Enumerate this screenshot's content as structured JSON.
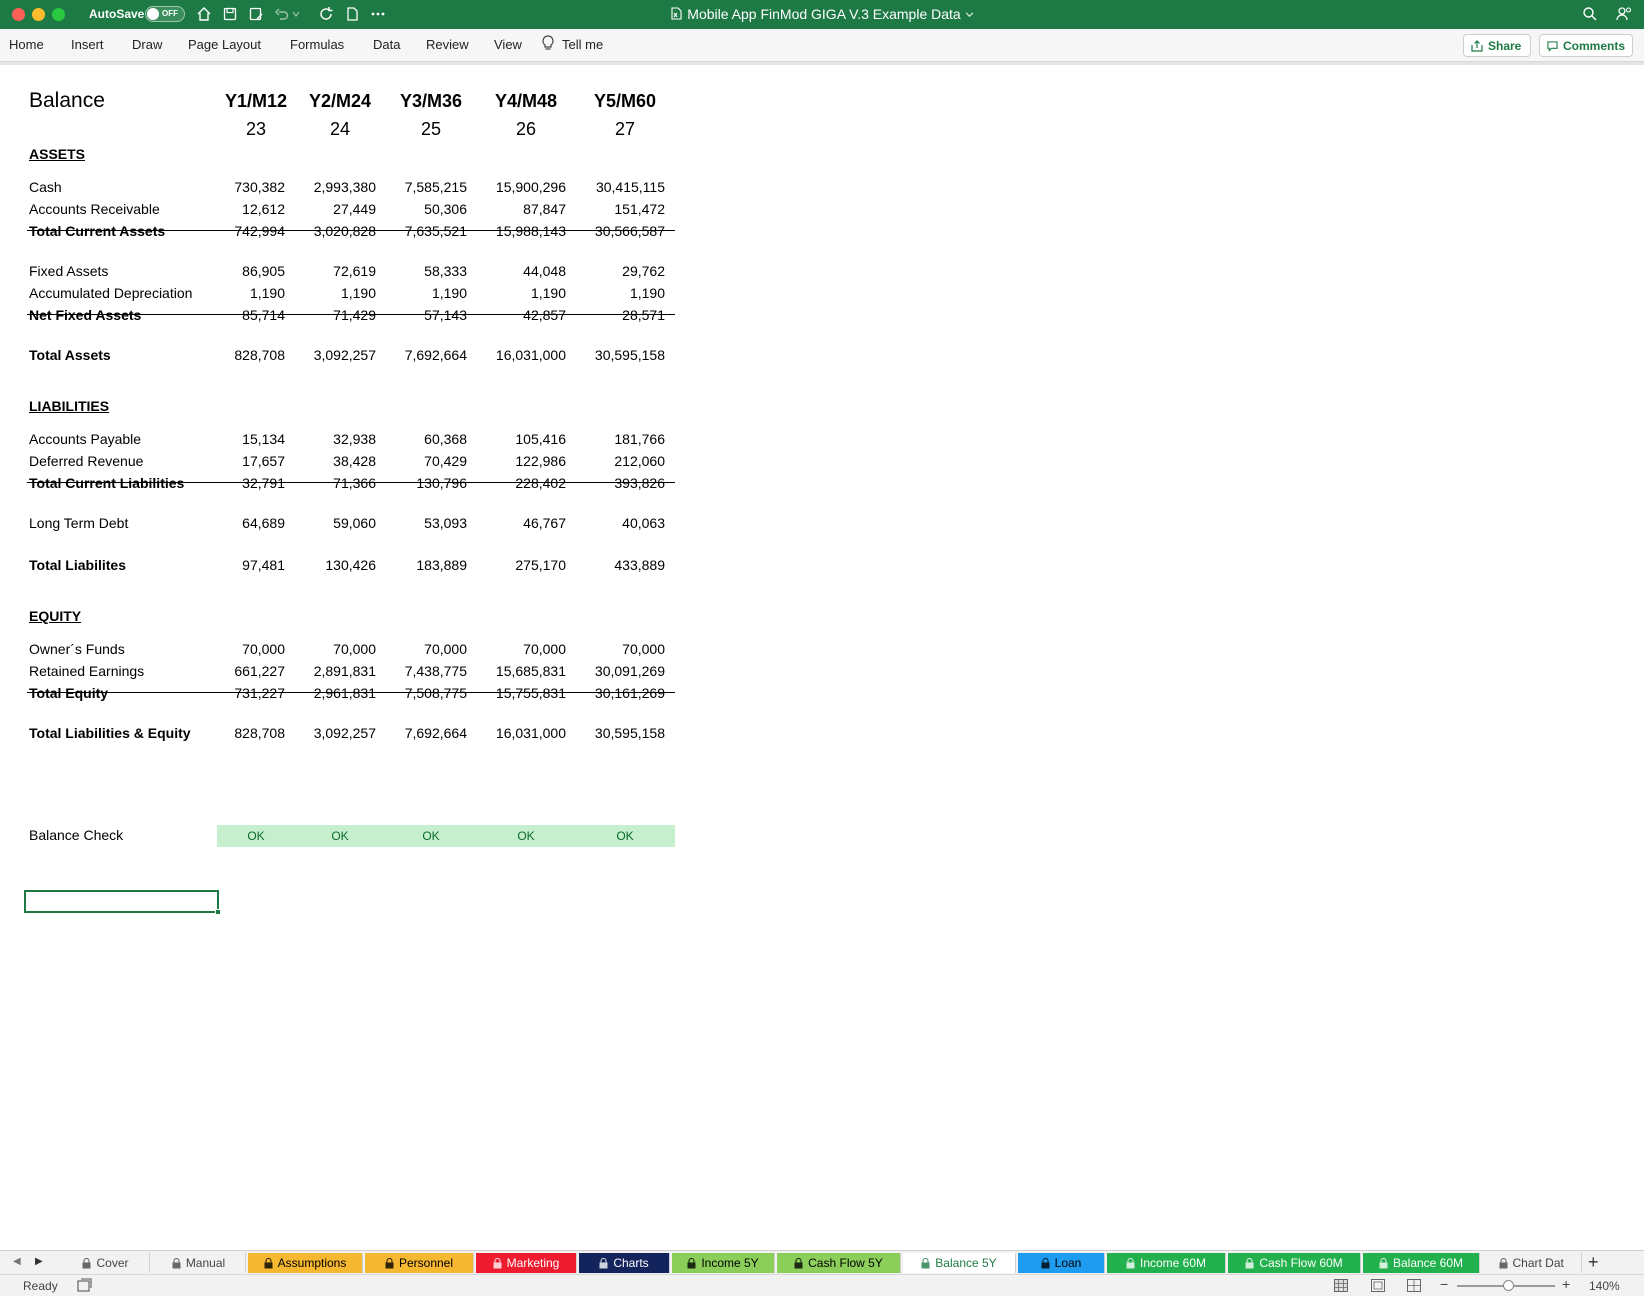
{
  "titlebar": {
    "autosave_label": "AutoSave",
    "autosave_state": "OFF",
    "document_title": "Mobile App FinMod GIGA V.3 Example Data"
  },
  "ribbon": {
    "menu": [
      "Home",
      "Insert",
      "Draw",
      "Page Layout",
      "Formulas",
      "Data",
      "Review",
      "View",
      "Tell me"
    ],
    "share_label": "Share",
    "comments_label": "Comments"
  },
  "sheet": {
    "title": "Balance",
    "columns": [
      "Y1/M12",
      "Y2/M24",
      "Y3/M36",
      "Y4/M48",
      "Y5/M60"
    ],
    "column_numbers": [
      "23",
      "24",
      "25",
      "26",
      "27"
    ],
    "sections": {
      "assets": "ASSETS",
      "liabilities": "LIABILITIES",
      "equity": "EQUITY"
    },
    "rows": [
      {
        "label": "Cash",
        "values": [
          "730,382",
          "2,993,380",
          "7,585,215",
          "15,900,296",
          "30,415,115"
        ]
      },
      {
        "label": "Accounts Receivable",
        "values": [
          "12,612",
          "27,449",
          "50,306",
          "87,847",
          "151,472"
        ]
      },
      {
        "label": "Total Current Assets",
        "values": [
          "742,994",
          "3,020,828",
          "7,635,521",
          "15,988,143",
          "30,566,587"
        ]
      },
      {
        "label": "Fixed Assets",
        "values": [
          "86,905",
          "72,619",
          "58,333",
          "44,048",
          "29,762"
        ]
      },
      {
        "label": "Accumulated Depreciation",
        "values": [
          "1,190",
          "1,190",
          "1,190",
          "1,190",
          "1,190"
        ]
      },
      {
        "label": "Net Fixed Assets",
        "values": [
          "85,714",
          "71,429",
          "57,143",
          "42,857",
          "28,571"
        ]
      },
      {
        "label": "Total Assets",
        "values": [
          "828,708",
          "3,092,257",
          "7,692,664",
          "16,031,000",
          "30,595,158"
        ]
      },
      {
        "label": "Accounts Payable",
        "values": [
          "15,134",
          "32,938",
          "60,368",
          "105,416",
          "181,766"
        ]
      },
      {
        "label": "Deferred Revenue",
        "values": [
          "17,657",
          "38,428",
          "70,429",
          "122,986",
          "212,060"
        ]
      },
      {
        "label": "Total Current Liabilities",
        "values": [
          "32,791",
          "71,366",
          "130,796",
          "228,402",
          "393,826"
        ]
      },
      {
        "label": "Long Term Debt",
        "values": [
          "64,689",
          "59,060",
          "53,093",
          "46,767",
          "40,063"
        ]
      },
      {
        "label": "Total Liabilites",
        "values": [
          "97,481",
          "130,426",
          "183,889",
          "275,170",
          "433,889"
        ]
      },
      {
        "label": "Owner´s Funds",
        "values": [
          "70,000",
          "70,000",
          "70,000",
          "70,000",
          "70,000"
        ]
      },
      {
        "label": "Retained Earnings",
        "values": [
          "661,227",
          "2,891,831",
          "7,438,775",
          "15,685,831",
          "30,091,269"
        ]
      },
      {
        "label": "Total Equity",
        "values": [
          "731,227",
          "2,961,831",
          "7,508,775",
          "15,755,831",
          "30,161,269"
        ]
      },
      {
        "label": "Total Liabilities & Equity",
        "values": [
          "828,708",
          "3,092,257",
          "7,692,664",
          "16,031,000",
          "30,595,158"
        ]
      }
    ],
    "balance_check": {
      "label": "Balance Check",
      "values": [
        "OK",
        "OK",
        "OK",
        "OK",
        "OK"
      ],
      "fill_color": "#c6efce",
      "text_color": "#0b6b2a"
    }
  },
  "tabs": [
    {
      "label": "Cover",
      "bg": "#f2f2f2",
      "fg": "#444444"
    },
    {
      "label": "Manual",
      "bg": "#f2f2f2",
      "fg": "#444444"
    },
    {
      "label": "Assumptions",
      "bg": "#f6b731",
      "fg": "#000000"
    },
    {
      "label": "Personnel",
      "bg": "#f6b731",
      "fg": "#000000"
    },
    {
      "label": "Marketing",
      "bg": "#ee1c2e",
      "fg": "#ffffff"
    },
    {
      "label": "Charts",
      "bg": "#13235b",
      "fg": "#ffffff"
    },
    {
      "label": "Income 5Y",
      "bg": "#8bcf5a",
      "fg": "#000000"
    },
    {
      "label": "Cash Flow 5Y",
      "bg": "#8bcf5a",
      "fg": "#000000"
    },
    {
      "label": "Balance 5Y",
      "bg": "#ffffff",
      "fg": "#1e7a45"
    },
    {
      "label": "Loan",
      "bg": "#1e9cf0",
      "fg": "#000000"
    },
    {
      "label": "Income 60M",
      "bg": "#22b14c",
      "fg": "#ffffff"
    },
    {
      "label": "Cash Flow 60M",
      "bg": "#22b14c",
      "fg": "#ffffff"
    },
    {
      "label": "Balance 60M",
      "bg": "#22b14c",
      "fg": "#ffffff"
    },
    {
      "label": "Chart Dat",
      "bg": "#f2f2f2",
      "fg": "#444444"
    }
  ],
  "statusbar": {
    "ready": "Ready",
    "zoom": "140%",
    "zoom_level_percent": 140
  },
  "colors": {
    "accent": "#1e7a45"
  }
}
